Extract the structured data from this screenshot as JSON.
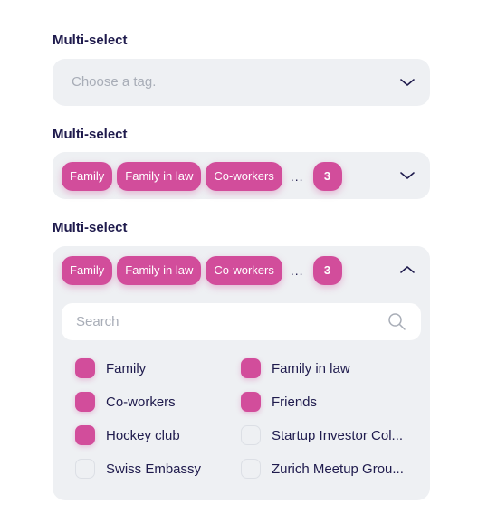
{
  "select1": {
    "label": "Multi-select",
    "placeholder": "Choose a tag."
  },
  "select2": {
    "label": "Multi-select",
    "chips": [
      "Family",
      "Family in law",
      "Co-workers"
    ],
    "ellipsis": "...",
    "count": "3"
  },
  "select3": {
    "label": "Multi-select",
    "chips": [
      "Family",
      "Family in law",
      "Co-workers"
    ],
    "ellipsis": "...",
    "count": "3",
    "search_placeholder": "Search",
    "options": [
      {
        "label": "Family",
        "checked": true
      },
      {
        "label": "Family in law",
        "checked": true
      },
      {
        "label": "Co-workers",
        "checked": true
      },
      {
        "label": "Friends",
        "checked": true
      },
      {
        "label": "Hockey club",
        "checked": true
      },
      {
        "label": "Startup Investor Col...",
        "checked": false
      },
      {
        "label": "Swiss Embassy",
        "checked": false
      },
      {
        "label": "Zurich Meetup Grou...",
        "checked": false
      }
    ]
  },
  "colors": {
    "accent": "#d24d9b",
    "field_bg": "#eef0f3",
    "text": "#1f1b4d",
    "placeholder": "#a8adb7"
  },
  "icons": {
    "collapsed": "chevron-down-icon",
    "expanded": "chevron-up-icon",
    "search": "search-icon"
  }
}
